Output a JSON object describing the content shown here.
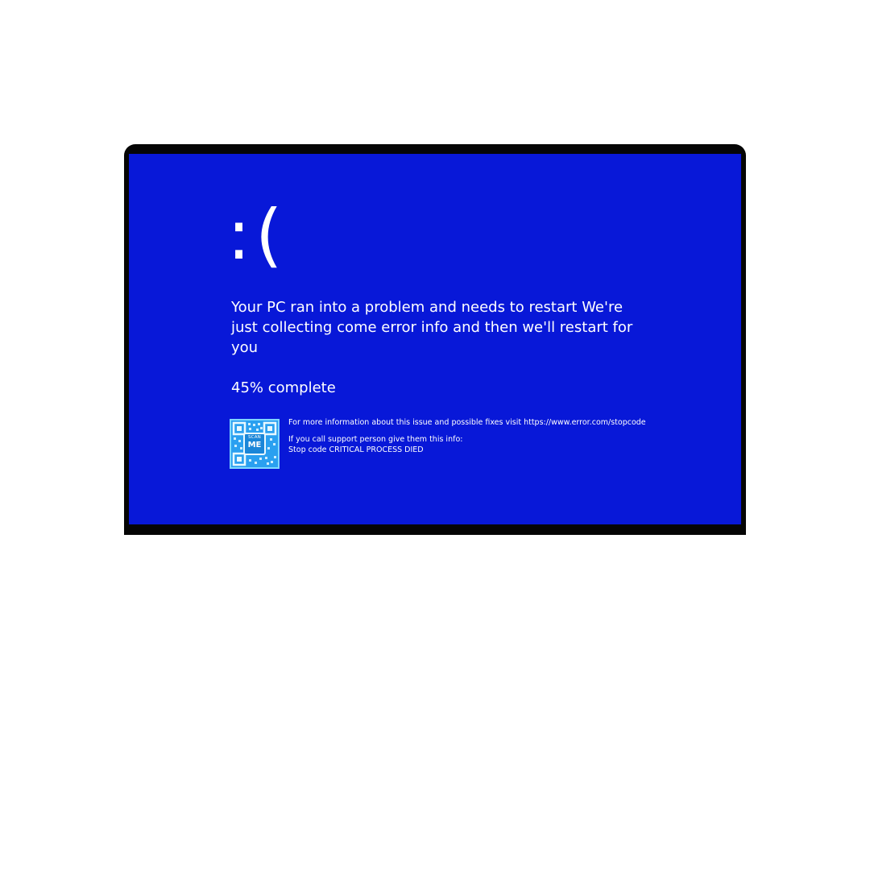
{
  "bsod": {
    "sad_face": ":(",
    "message": "Your PC ran into a problem and needs to restart  We're just collecting come error info  and then we'll restart for you",
    "progress": {
      "text": "45% complete",
      "percent": 45
    },
    "qr": {
      "label_top": "SCAN",
      "label_bottom": "ME"
    },
    "more_info": "For more information about this issue and possible fixes visit https://www.error.com/stopcode",
    "support_prompt": "If you call support person  give them this info:",
    "stop_code": "Stop code  CRITICAL  PROCESS  DIED"
  },
  "colors": {
    "screen_background": "#0818d8",
    "frame": "#050505",
    "text": "#ffffff",
    "qr_background": "#2aa0f0"
  }
}
